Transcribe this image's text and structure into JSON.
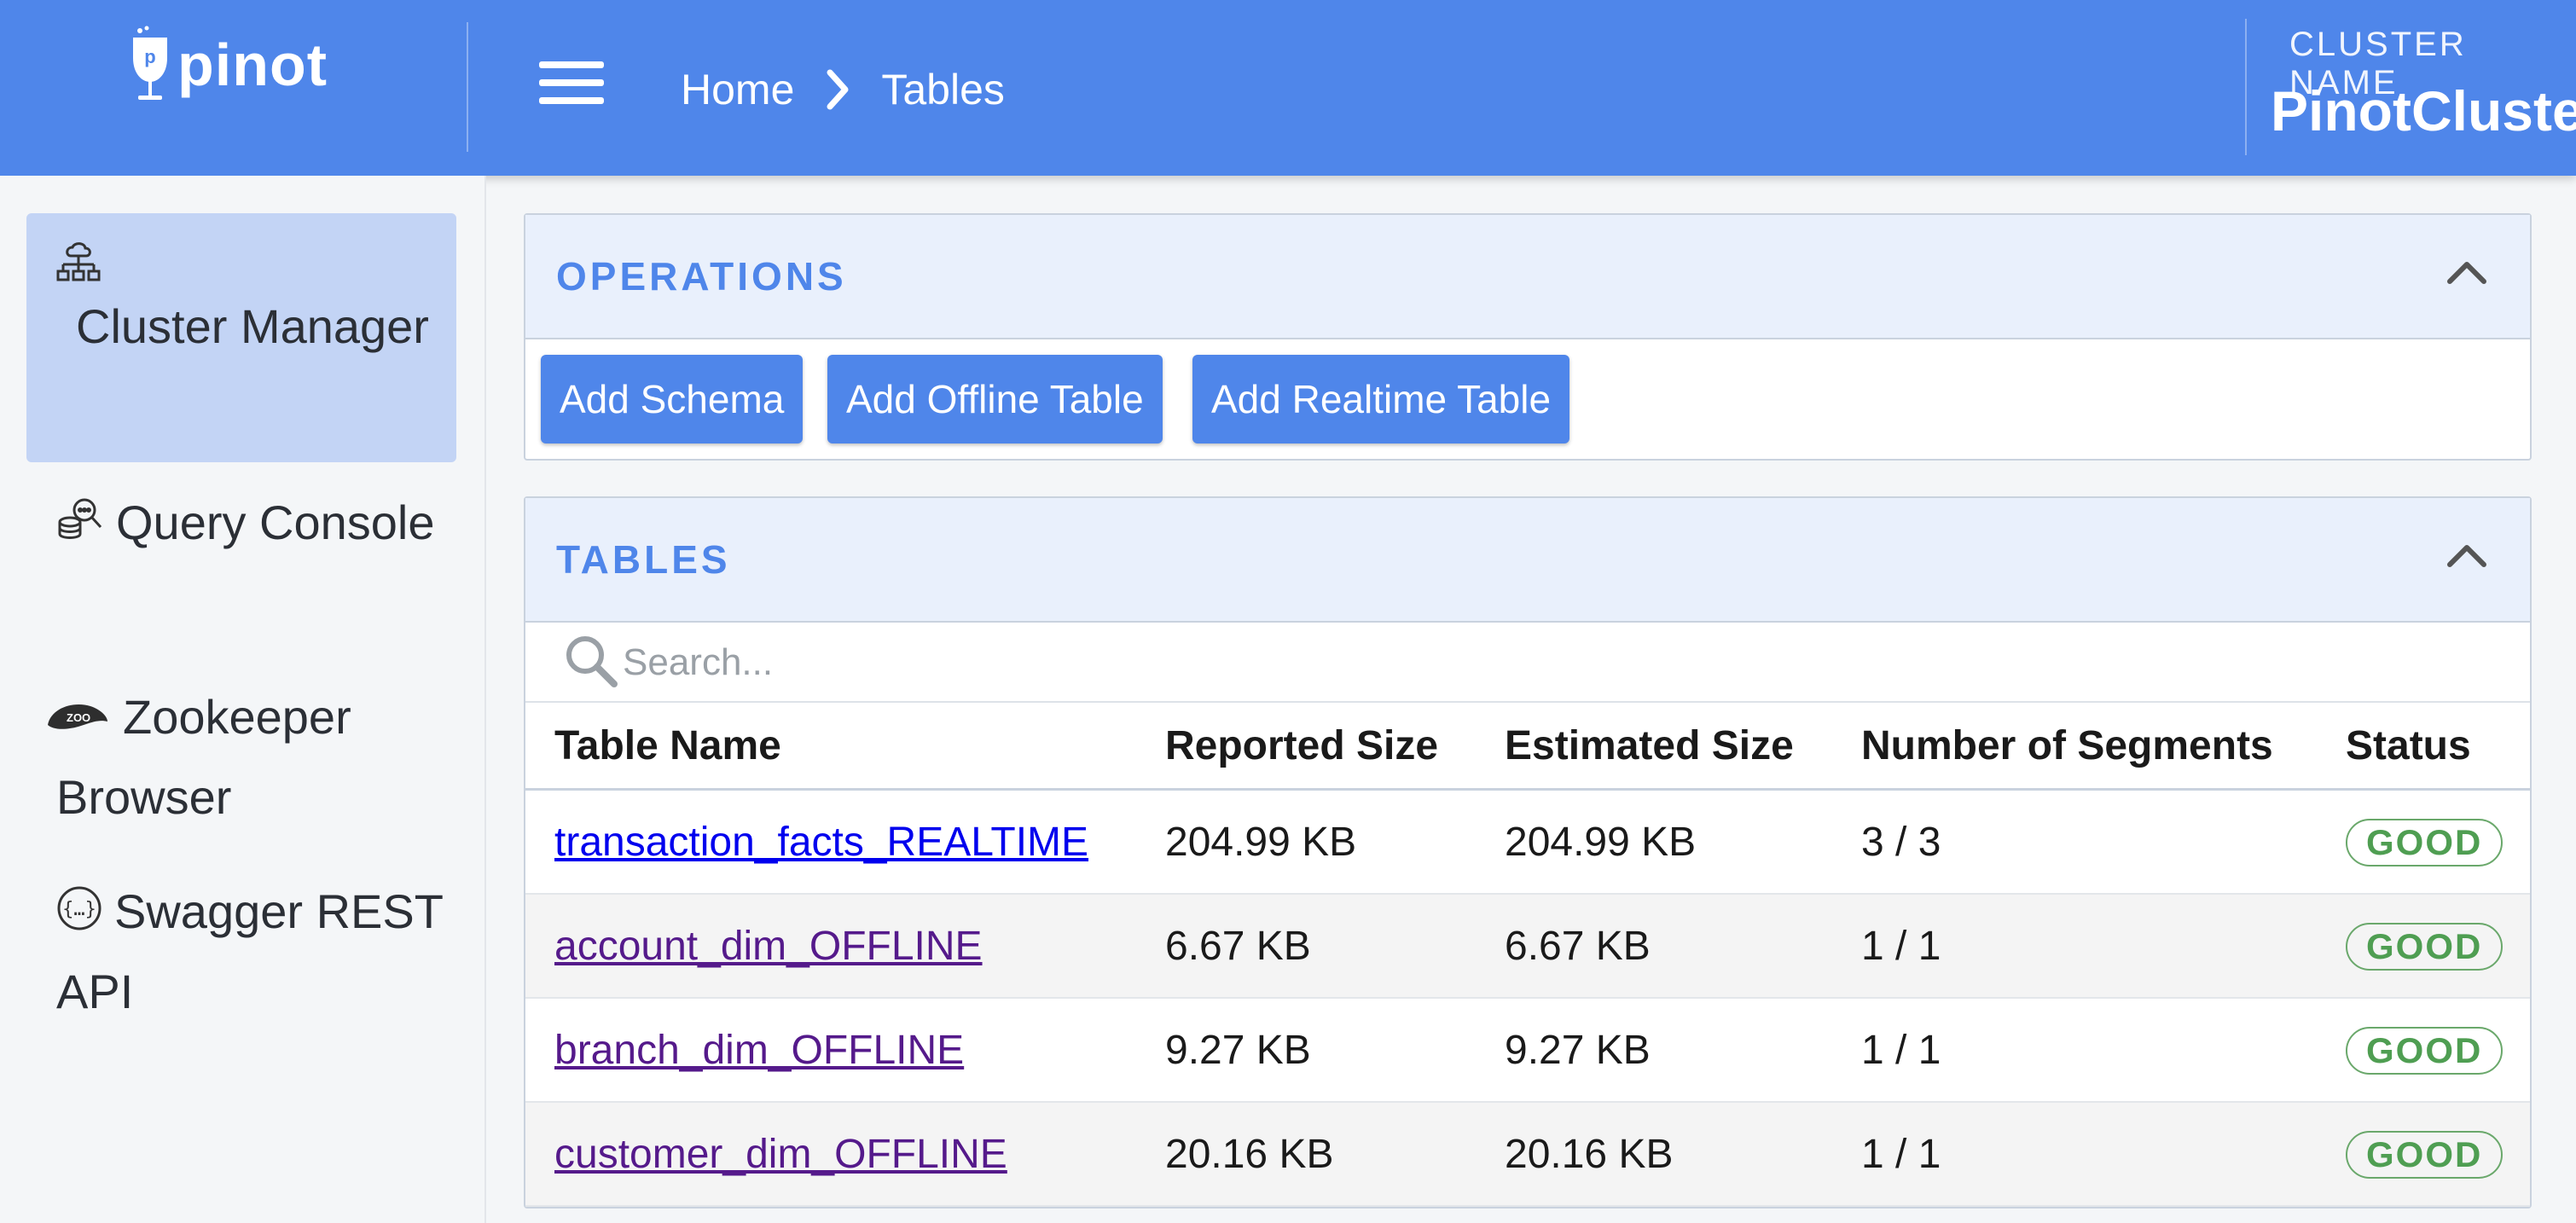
{
  "header": {
    "logo_text": "pinot",
    "breadcrumb": {
      "home": "Home",
      "current": "Tables"
    },
    "cluster_label": "CLUSTER NAME",
    "cluster_name": "PinotCluster"
  },
  "sidebar": {
    "items": [
      {
        "label": "Cluster Manager",
        "icon": "cluster-icon",
        "active": true
      },
      {
        "label": "Query Console",
        "icon": "query-icon"
      },
      {
        "label": "Zookeeper Browser",
        "icon": "zookeeper-icon"
      },
      {
        "label": "Swagger REST API",
        "icon": "swagger-icon"
      }
    ]
  },
  "operations": {
    "title": "OPERATIONS",
    "buttons": [
      "Add Schema",
      "Add Offline Table",
      "Add Realtime Table"
    ]
  },
  "tables": {
    "title": "TABLES",
    "search_placeholder": "Search...",
    "columns": [
      "Table Name",
      "Reported Size",
      "Estimated Size",
      "Number of Segments",
      "Status"
    ],
    "rows": [
      {
        "name": "transaction_facts_REALTIME",
        "reported": "204.99 KB",
        "estimated": "204.99 KB",
        "segments": "3 / 3",
        "status": "GOOD"
      },
      {
        "name": "account_dim_OFFLINE",
        "reported": "6.67 KB",
        "estimated": "6.67 KB",
        "segments": "1 / 1",
        "status": "GOOD"
      },
      {
        "name": "branch_dim_OFFLINE",
        "reported": "9.27 KB",
        "estimated": "9.27 KB",
        "segments": "1 / 1",
        "status": "GOOD"
      },
      {
        "name": "customer_dim_OFFLINE",
        "reported": "20.16 KB",
        "estimated": "20.16 KB",
        "segments": "1 / 1",
        "status": "GOOD"
      }
    ]
  },
  "colors": {
    "primary": "#4f86ea",
    "active_nav": "#c3d4f5",
    "good": "#4f9e52",
    "link": "#0000ee",
    "visited_link": "#551a8b"
  }
}
